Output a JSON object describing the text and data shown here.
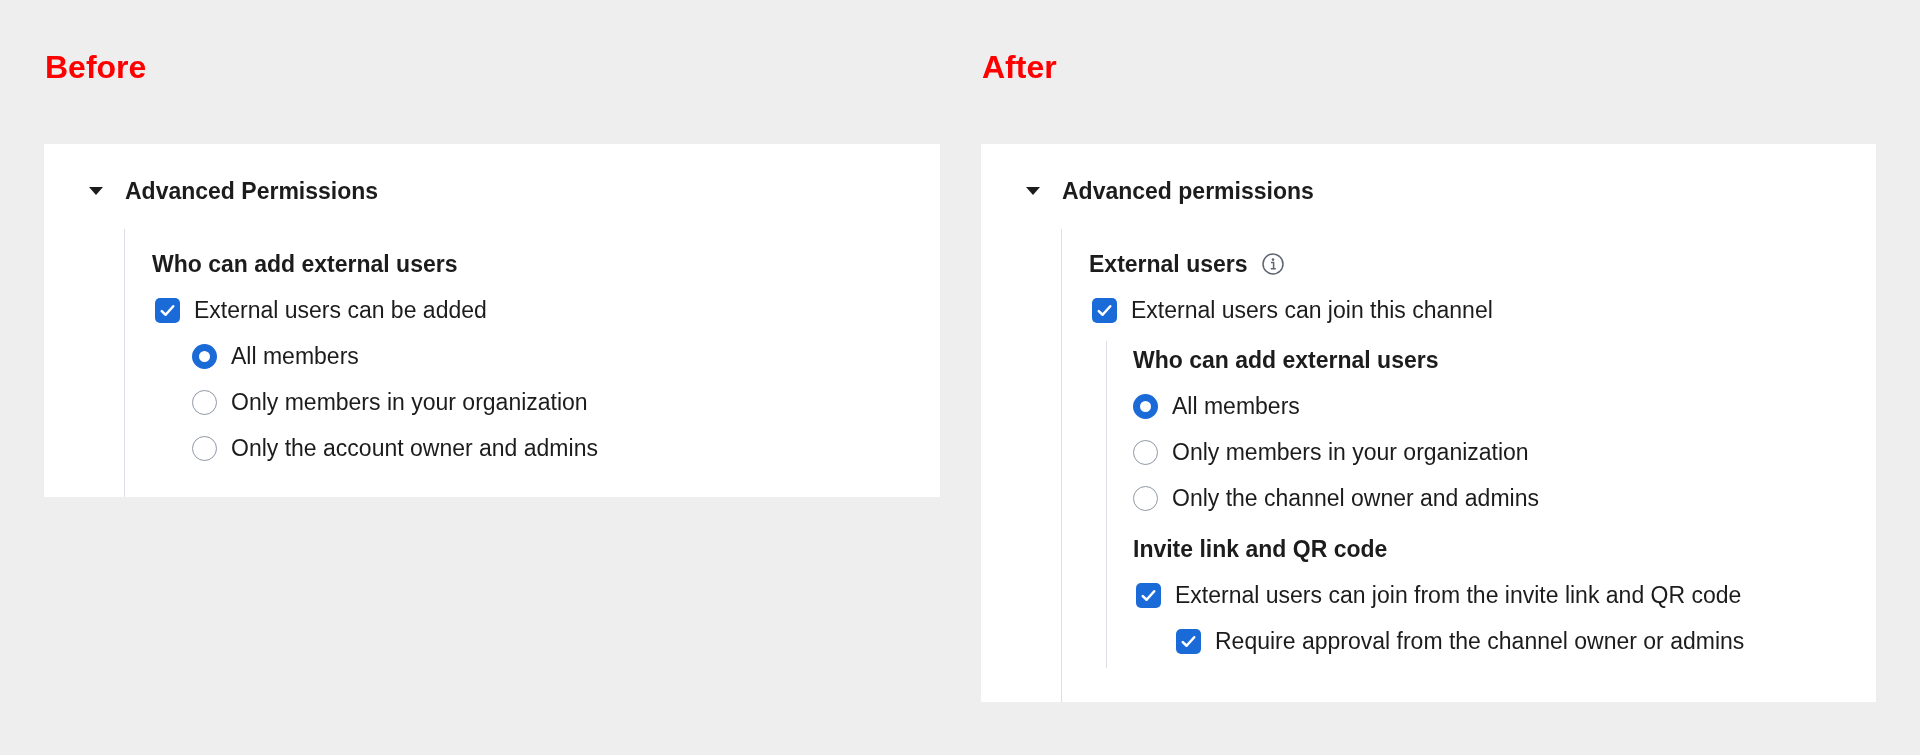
{
  "panels": [
    {
      "label": "Before",
      "section": {
        "title": "Advanced Permissions",
        "expanded": true,
        "items": [
          {
            "kind": "heading",
            "text": "Who can add external users",
            "info_icon": false
          },
          {
            "kind": "checkbox",
            "text": "External users can be added",
            "checked": true,
            "guide_line": false,
            "children": [
              {
                "kind": "radio",
                "text": "All members",
                "selected": true
              },
              {
                "kind": "radio",
                "text": "Only members in your organization",
                "selected": false
              },
              {
                "kind": "radio",
                "text": "Only the account owner and admins",
                "selected": false
              }
            ]
          }
        ]
      }
    },
    {
      "label": "After",
      "section": {
        "title": "Advanced permissions",
        "expanded": true,
        "items": [
          {
            "kind": "heading",
            "text": "External users",
            "info_icon": true
          },
          {
            "kind": "checkbox",
            "text": "External users can join this channel",
            "checked": true,
            "guide_line": true,
            "children": [
              {
                "kind": "heading",
                "text": "Who can add external users",
                "info_icon": false
              },
              {
                "kind": "radio",
                "text": "All members",
                "selected": true
              },
              {
                "kind": "radio",
                "text": "Only members in your organization",
                "selected": false
              },
              {
                "kind": "radio",
                "text": "Only the channel owner and admins",
                "selected": false
              },
              {
                "kind": "heading",
                "text": "Invite link and QR code",
                "info_icon": false
              },
              {
                "kind": "checkbox",
                "text": "External users can join from the invite link and QR code",
                "checked": true,
                "guide_line": false,
                "children": [
                  {
                    "kind": "checkbox",
                    "text": "Require approval from the channel owner or admins",
                    "checked": true
                  }
                ]
              }
            ]
          }
        ]
      }
    }
  ]
}
